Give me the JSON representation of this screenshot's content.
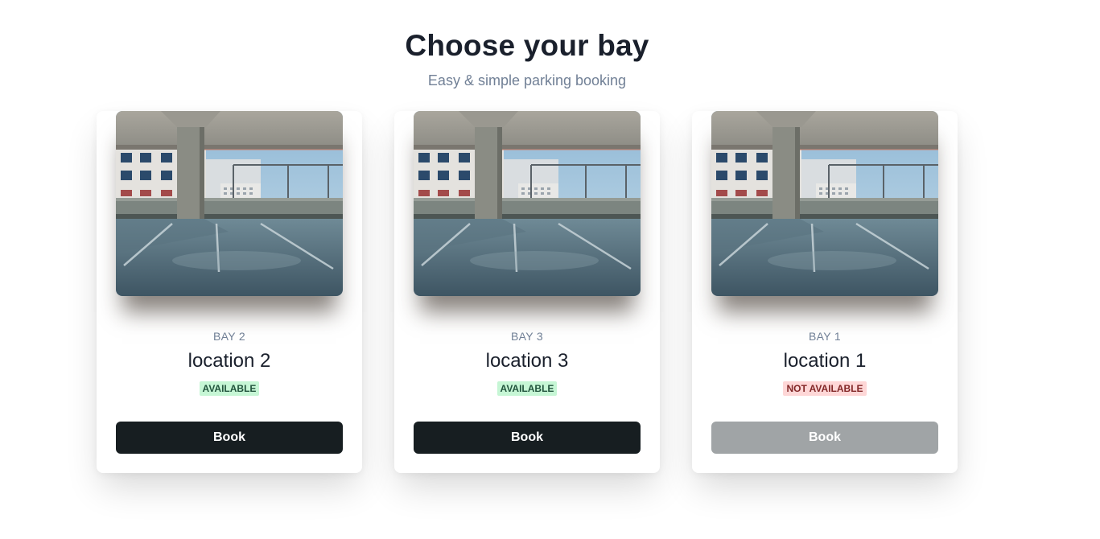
{
  "header": {
    "title": "Choose your bay",
    "subtitle": "Easy & simple parking booking"
  },
  "cards": [
    {
      "bay": "BAY 2",
      "location": "location 2",
      "status": "AVAILABLE",
      "available": true,
      "button_label": "Book",
      "image_icon": "parking-garage-photo"
    },
    {
      "bay": "BAY 3",
      "location": "location 3",
      "status": "AVAILABLE",
      "available": true,
      "button_label": "Book",
      "image_icon": "parking-garage-photo"
    },
    {
      "bay": "BAY 1",
      "location": "location 1",
      "status": "NOT AVAILABLE",
      "available": false,
      "button_label": "Book",
      "image_icon": "parking-garage-photo"
    }
  ],
  "colors": {
    "available_bg": "#c6f6d5",
    "available_text": "#22543d",
    "unavailable_bg": "#fed7d7",
    "unavailable_text": "#822727",
    "button": "#171e21",
    "button_disabled": "#a0a4a6"
  }
}
